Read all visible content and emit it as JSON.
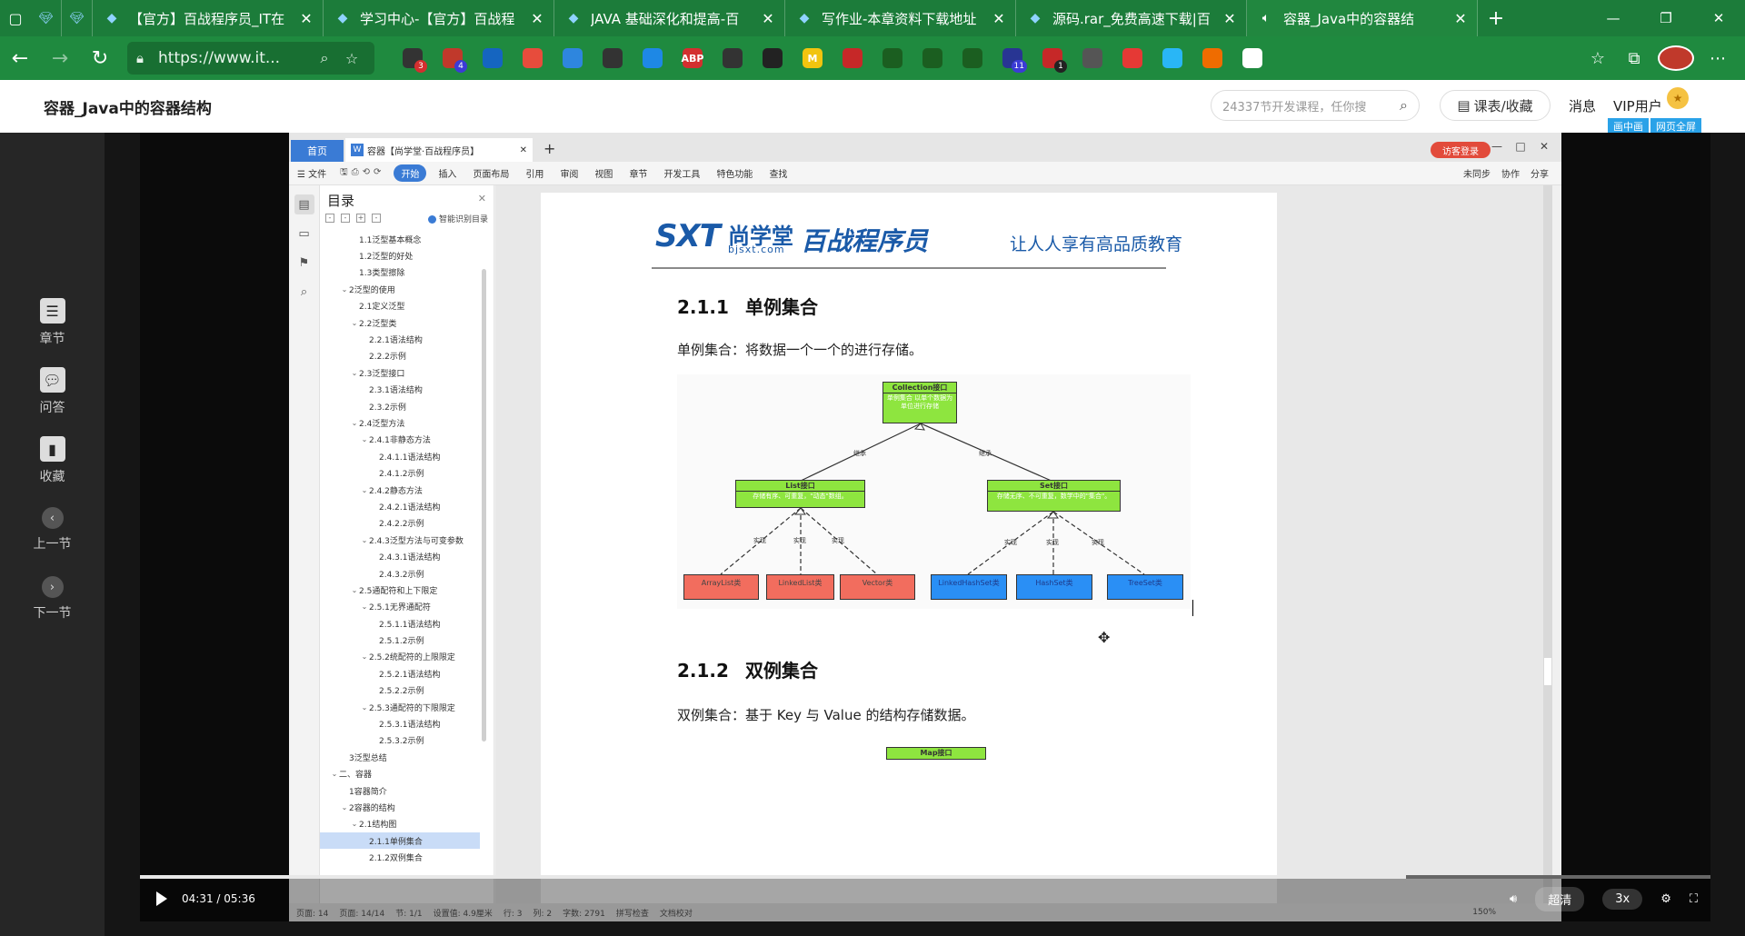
{
  "browser": {
    "tabs": [
      {
        "title": "",
        "small": true
      },
      {
        "title": "",
        "small": true
      },
      {
        "title": "【官方】百战程序员_IT在",
        "active": false
      },
      {
        "title": "学习中心-【官方】百战程",
        "active": false
      },
      {
        "title": "JAVA 基础深化和提高-百",
        "active": false
      },
      {
        "title": "写作业-本章资料下载地址",
        "active": false
      },
      {
        "title": "源码.rar_免费高速下载|百",
        "active": false
      },
      {
        "title": "容器_Java中的容器结",
        "active": true
      }
    ],
    "url": "https://www.it...",
    "extensions": [
      {
        "icon": "record-icon",
        "color": "#333333",
        "badge": "3",
        "badge_color": "red"
      },
      {
        "icon": "game-icon",
        "color": "#c0392b",
        "badge": "4",
        "badge_color": "blue"
      },
      {
        "icon": "tiktok-icon",
        "color": "#1565c0",
        "badge": ""
      },
      {
        "icon": "note-icon",
        "color": "#e74c3c",
        "badge": ""
      },
      {
        "icon": "grid-icon",
        "color": "#2e86de",
        "badge": ""
      },
      {
        "icon": "calc-icon",
        "color": "#333333",
        "badge": ""
      },
      {
        "icon": "gem-icon",
        "color": "#1e88e5",
        "badge": ""
      },
      {
        "icon": "abp-icon",
        "color": "#d32f2f",
        "badge": "",
        "text": "ABP"
      },
      {
        "icon": "mountain-icon",
        "color": "#333333",
        "badge": ""
      },
      {
        "icon": "asterisk-icon",
        "color": "#222222",
        "badge": ""
      },
      {
        "icon": "m-icon",
        "color": "#f1c40f",
        "badge": "",
        "text": "M"
      },
      {
        "icon": "shield-block-icon",
        "color": "#c62828",
        "badge": ""
      },
      {
        "icon": "fx-icon",
        "color": "#1b5e20",
        "badge": ""
      },
      {
        "icon": "diamond-icon",
        "color": "#1b5e20",
        "badge": ""
      },
      {
        "icon": "brace-icon",
        "color": "#1b5e20",
        "badge": ""
      },
      {
        "icon": "hat-icon",
        "color": "#283593",
        "badge": "11",
        "badge_color": "blue"
      },
      {
        "icon": "dice-icon",
        "color": "#c62828",
        "badge": "1",
        "badge_color": "dark"
      },
      {
        "icon": "camera-icon",
        "color": "#555555",
        "badge": ""
      },
      {
        "icon": "pie-icon",
        "color": "#e53935",
        "badge": ""
      },
      {
        "icon": "circle-icon",
        "color": "#29b6f6",
        "badge": ""
      },
      {
        "icon": "fox-icon",
        "color": "#ef6c00",
        "badge": ""
      },
      {
        "icon": "puzzle-icon",
        "color": "#ffffff",
        "badge": ""
      }
    ]
  },
  "site": {
    "title": "容器_Java中的容器结构",
    "search_placeholder": "24337节开发课程，任你搜",
    "course_btn": "课表/收藏",
    "message": "消息",
    "vip": "VIP用户",
    "pip": "画中画",
    "webfull": "网页全屏"
  },
  "sidebar": {
    "items": [
      {
        "label": "章节",
        "icon": "chapter-icon"
      },
      {
        "label": "问答",
        "icon": "qa-icon"
      },
      {
        "label": "收藏",
        "icon": "bookmark-icon"
      },
      {
        "label": "上一节",
        "icon": "prev-icon"
      },
      {
        "label": "下一节",
        "icon": "next-icon"
      }
    ]
  },
  "wps": {
    "home_tab": "首页",
    "doc_tab": "容器【尚学堂·百战程序员】",
    "visitor": "访客登录",
    "menu": [
      "开始",
      "插入",
      "页面布局",
      "引用",
      "审阅",
      "视图",
      "章节",
      "开发工具",
      "特色功能",
      "查找"
    ],
    "file_menu": "文件",
    "right_menu": [
      "未同步",
      "协作",
      "分享"
    ],
    "toc_title": "目录",
    "smart_toc": "智能识别目录",
    "toc": [
      {
        "text": "1.1泛型基本概念",
        "indent": 3,
        "caret": ""
      },
      {
        "text": "1.2泛型的好处",
        "indent": 3,
        "caret": ""
      },
      {
        "text": "1.3类型擦除",
        "indent": 3,
        "caret": ""
      },
      {
        "text": "2泛型的使用",
        "indent": 2,
        "caret": "v"
      },
      {
        "text": "2.1定义泛型",
        "indent": 3,
        "caret": ""
      },
      {
        "text": "2.2泛型类",
        "indent": 3,
        "caret": "v"
      },
      {
        "text": "2.2.1语法结构",
        "indent": 4,
        "caret": ""
      },
      {
        "text": "2.2.2示例",
        "indent": 4,
        "caret": ""
      },
      {
        "text": "2.3泛型接口",
        "indent": 3,
        "caret": "v"
      },
      {
        "text": "2.3.1语法结构",
        "indent": 4,
        "caret": ""
      },
      {
        "text": "2.3.2示例",
        "indent": 4,
        "caret": ""
      },
      {
        "text": "2.4泛型方法",
        "indent": 3,
        "caret": "v"
      },
      {
        "text": "2.4.1非静态方法",
        "indent": 4,
        "caret": "v"
      },
      {
        "text": "2.4.1.1语法结构",
        "indent": 5,
        "caret": ""
      },
      {
        "text": "2.4.1.2示例",
        "indent": 5,
        "caret": ""
      },
      {
        "text": "2.4.2静态方法",
        "indent": 4,
        "caret": "v"
      },
      {
        "text": "2.4.2.1语法结构",
        "indent": 5,
        "caret": ""
      },
      {
        "text": "2.4.2.2示例",
        "indent": 5,
        "caret": ""
      },
      {
        "text": "2.4.3泛型方法与可变参数",
        "indent": 4,
        "caret": "v"
      },
      {
        "text": "2.4.3.1语法结构",
        "indent": 5,
        "caret": ""
      },
      {
        "text": "2.4.3.2示例",
        "indent": 5,
        "caret": ""
      },
      {
        "text": "2.5通配符和上下限定",
        "indent": 3,
        "caret": "v"
      },
      {
        "text": "2.5.1无界通配符",
        "indent": 4,
        "caret": "v"
      },
      {
        "text": "2.5.1.1语法结构",
        "indent": 5,
        "caret": ""
      },
      {
        "text": "2.5.1.2示例",
        "indent": 5,
        "caret": ""
      },
      {
        "text": "2.5.2统配符的上限限定",
        "indent": 4,
        "caret": "v"
      },
      {
        "text": "2.5.2.1语法结构",
        "indent": 5,
        "caret": ""
      },
      {
        "text": "2.5.2.2示例",
        "indent": 5,
        "caret": ""
      },
      {
        "text": "2.5.3通配符的下限限定",
        "indent": 4,
        "caret": "v"
      },
      {
        "text": "2.5.3.1语法结构",
        "indent": 5,
        "caret": ""
      },
      {
        "text": "2.5.3.2示例",
        "indent": 5,
        "caret": ""
      },
      {
        "text": "3泛型总结",
        "indent": 2,
        "caret": ""
      },
      {
        "text": "二、容器",
        "indent": 1,
        "caret": "v"
      },
      {
        "text": "1容器简介",
        "indent": 2,
        "caret": ""
      },
      {
        "text": "2容器的结构",
        "indent": 2,
        "caret": "v"
      },
      {
        "text": "2.1结构图",
        "indent": 3,
        "caret": "v"
      },
      {
        "text": "2.1.1单例集合",
        "indent": 4,
        "caret": "",
        "selected": true
      },
      {
        "text": "2.1.2双例集合",
        "indent": 4,
        "caret": ""
      }
    ],
    "status": [
      "页面: 14",
      "页面: 14/14",
      "节: 1/1",
      "设置值: 4.9厘米",
      "行: 3",
      "列: 2",
      "字数: 2791",
      "拼写检查",
      "文档校对"
    ],
    "zoom": "150%"
  },
  "document": {
    "logo_sxt": "SXT",
    "logo_cn": "尚学堂",
    "logo_sub": "bjsxt.com",
    "logo_bz": "百战程序员",
    "slogan": "让人人享有高品质教育",
    "h_211_num": "2.1.1",
    "h_211_title": "单例集合",
    "p_211": "单例集合：将数据一个一个的进行存储。",
    "h_212_num": "2.1.2",
    "h_212_title": "双例集合",
    "p_212": "双例集合：基于 Key 与 Value 的结构存储数据。",
    "map_stub": "Map接口",
    "diagram": {
      "collection": {
        "title": "Collection接口",
        "desc": "单例集合 以单个数据为单位进行存储"
      },
      "list": {
        "title": "List接口",
        "desc": "存储有序、可重复，\"动态\"数组。"
      },
      "set": {
        "title": "Set接口",
        "desc": "存储无序、不可重复，数学中的\"集合\"。"
      },
      "inherit": "继承",
      "impl": "实现",
      "list_impls": [
        "ArrayList类",
        "LinkedList类",
        "Vector类"
      ],
      "set_impls": [
        "LinkedHashSet类",
        "HashSet类",
        "TreeSet类"
      ]
    }
  },
  "video": {
    "time": "04:31 / 05:36",
    "progress": 0.806,
    "quality": "超清",
    "speed": "3x"
  }
}
